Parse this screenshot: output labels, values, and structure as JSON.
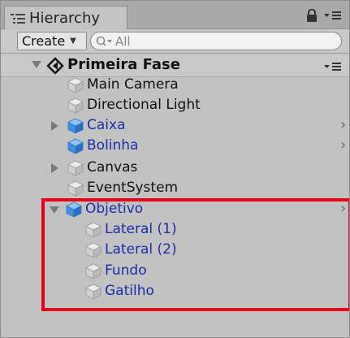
{
  "tab": {
    "title": "Hierarchy",
    "icon": "hierarchy-list-icon"
  },
  "toolbar": {
    "create_label": "Create",
    "search_placeholder": "All"
  },
  "scene": {
    "name": "Primeira Fase",
    "icon": "unity-logo-icon"
  },
  "items": [
    {
      "label": "Main Camera",
      "color": "#111111",
      "icon": "gray-cube-icon"
    },
    {
      "label": "Directional Light",
      "color": "#111111",
      "icon": "gray-cube-icon"
    },
    {
      "label": "Caixa",
      "color": "#1b2ea8",
      "icon": "blue-cube-icon",
      "collapsed": true
    },
    {
      "label": "Bolinha",
      "color": "#1b2ea8",
      "icon": "blue-cube-icon"
    },
    {
      "label": "Canvas",
      "color": "#111111",
      "icon": "gray-cube-icon",
      "collapsed": true
    },
    {
      "label": "EventSystem",
      "color": "#111111",
      "icon": "gray-cube-icon"
    },
    {
      "label": "Objetivo",
      "color": "#1b2ea8",
      "icon": "blue-cube-icon",
      "expanded": true
    },
    {
      "label": "Lateral (1)",
      "color": "#1b2ea8",
      "icon": "gray-cube-icon"
    },
    {
      "label": "Lateral (2)",
      "color": "#1b2ea8",
      "icon": "gray-cube-icon"
    },
    {
      "label": "Fundo",
      "color": "#1b2ea8",
      "icon": "gray-cube-icon"
    },
    {
      "label": "Gatilho",
      "color": "#1b2ea8",
      "icon": "gray-cube-icon"
    }
  ],
  "highlight_color": "#e8001b"
}
